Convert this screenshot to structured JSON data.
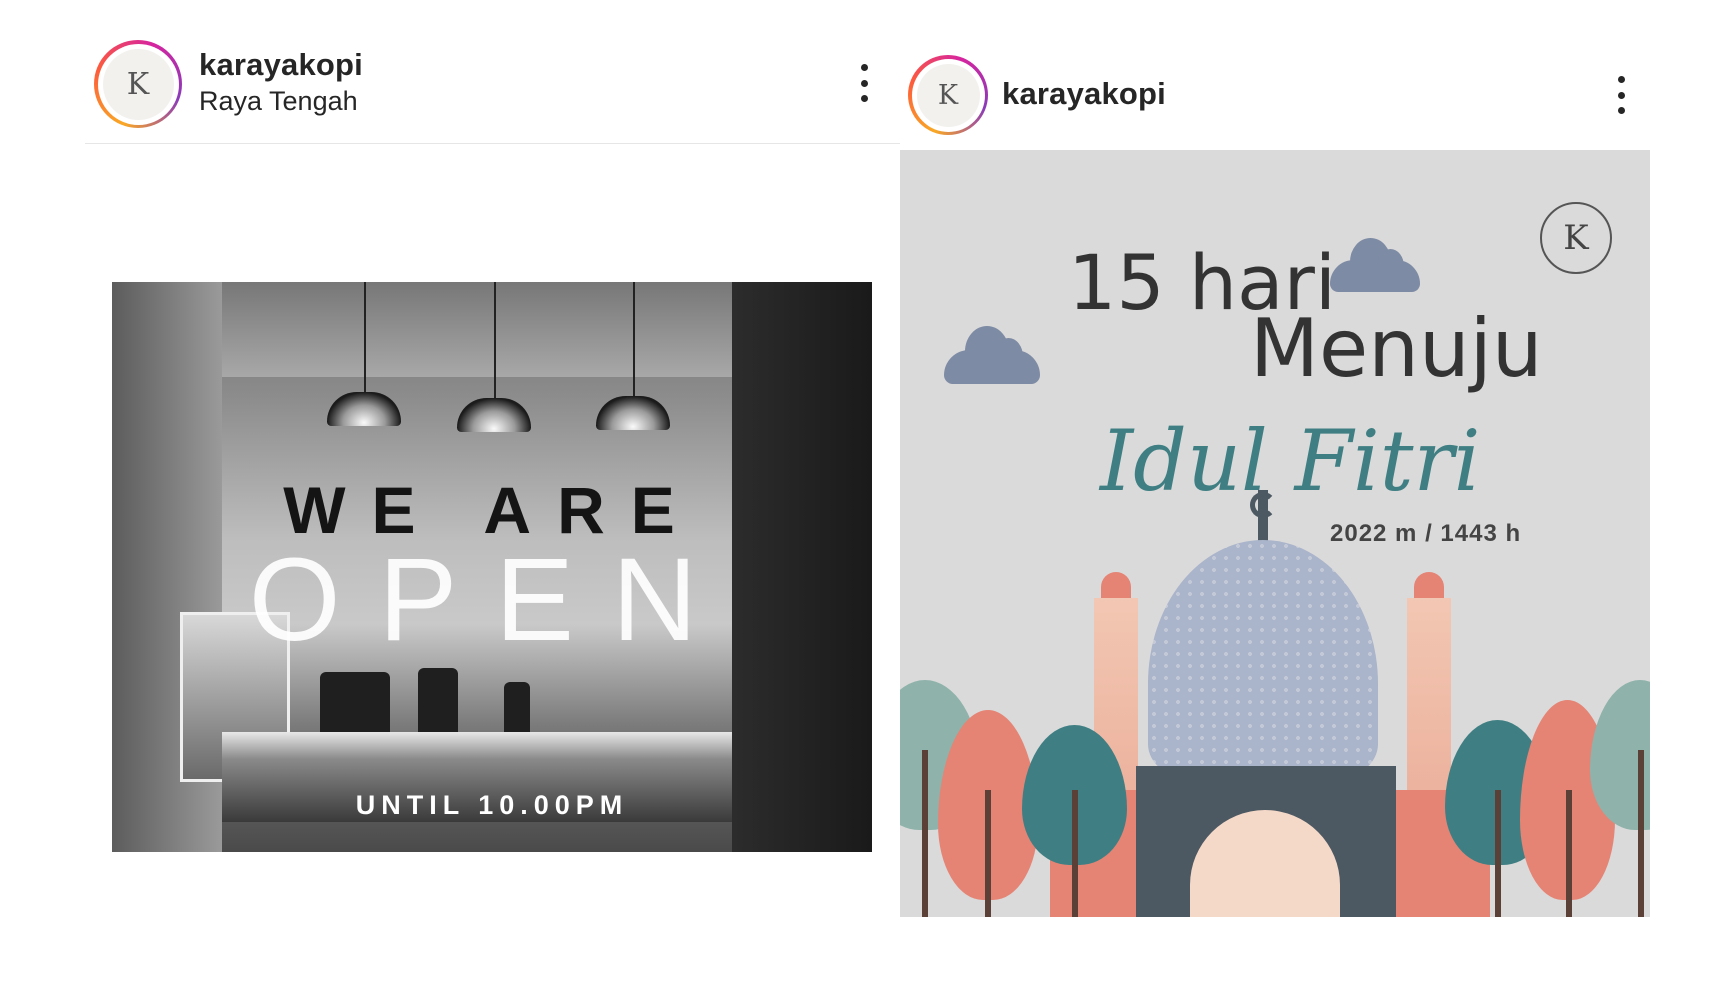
{
  "posts": [
    {
      "username": "karayakopi",
      "location": "Raya Tengah",
      "avatar_text": "K",
      "image_text": {
        "line1": "WE ARE",
        "line2": "OPEN",
        "line3": "UNTIL 10.00PM"
      }
    },
    {
      "username": "karayakopi",
      "avatar_text": "K",
      "image_text": {
        "line1": "15 hari",
        "line2": "Menuju",
        "line3": "Idul Fitri",
        "line4": "2022 m / 1443 h"
      },
      "brand_mark": "K"
    }
  ],
  "icons": {
    "more": "more-vertical-icon",
    "avatar": "brand-logo-icon"
  },
  "colors": {
    "ring_gradient": [
      "#f9a825",
      "#fd5c3c",
      "#d6249f",
      "#8a3ab9"
    ],
    "text": "#262626",
    "teal": "#3f7f83",
    "cloud": "#7e8ba4"
  }
}
